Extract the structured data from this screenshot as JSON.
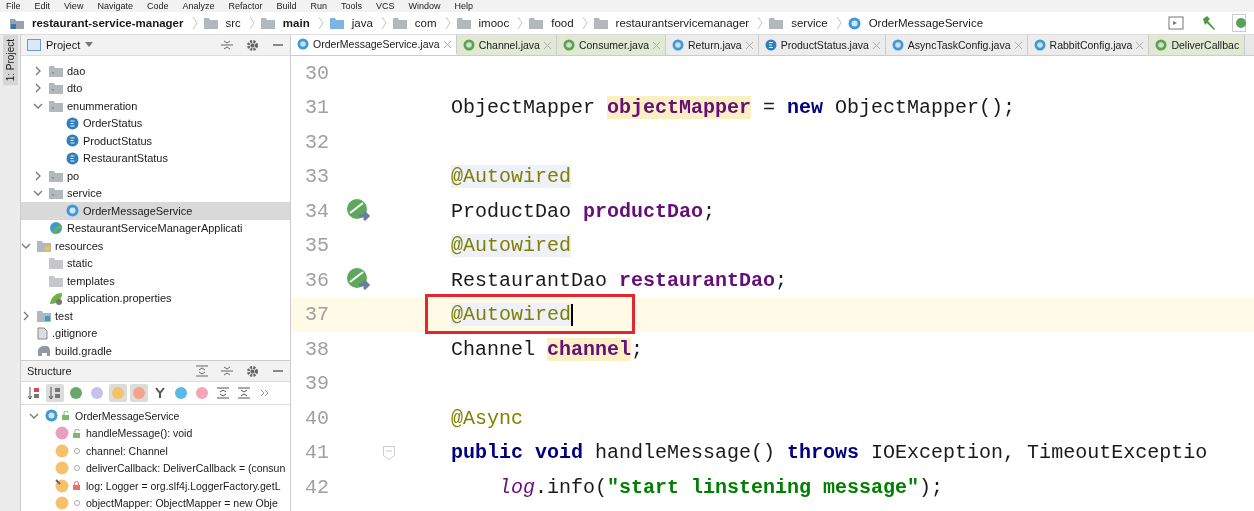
{
  "menu": [
    "File",
    "Edit",
    "View",
    "Navigate",
    "Code",
    "Analyze",
    "Refactor",
    "Build",
    "Run",
    "Tools",
    "VCS",
    "Window",
    "Help"
  ],
  "breadcrumb": [
    {
      "label": "restaurant-service-manager",
      "kind": "module"
    },
    {
      "label": "src",
      "kind": "folder"
    },
    {
      "label": "main",
      "kind": "sourceset"
    },
    {
      "label": "java",
      "kind": "source"
    },
    {
      "label": "com",
      "kind": "folder"
    },
    {
      "label": "imooc",
      "kind": "folder"
    },
    {
      "label": "food",
      "kind": "folder"
    },
    {
      "label": "restaurantservicemanager",
      "kind": "folder"
    },
    {
      "label": "service",
      "kind": "folder"
    },
    {
      "label": "OrderMessageService",
      "kind": "class"
    }
  ],
  "side_strip": {
    "label": "1: Project"
  },
  "project": {
    "title": "Project",
    "tree": [
      {
        "children": [
          {
            "children": [
              {
                "label": "dao",
                "kind": "package",
                "expanded": false,
                "selected": false
              },
              {
                "label": "dto",
                "kind": "package",
                "expanded": false,
                "selected": false
              },
              {
                "label": "enummeration",
                "kind": "package",
                "expanded": true,
                "selected": false,
                "children": [
                  {
                    "label": "OrderStatus",
                    "kind": "enum",
                    "selected": false
                  },
                  {
                    "label": "ProductStatus",
                    "kind": "enum",
                    "selected": false
                  },
                  {
                    "label": "RestaurantStatus",
                    "kind": "enum",
                    "selected": false
                  }
                ]
              },
              {
                "label": "po",
                "kind": "package",
                "expanded": false,
                "selected": false
              },
              {
                "label": "service",
                "kind": "package",
                "expanded": true,
                "selected": false,
                "children": [
                  {
                    "label": "OrderMessageService",
                    "kind": "class",
                    "selected": true
                  }
                ]
              },
              {
                "label": "RestaurantServiceManagerApplicati",
                "kind": "app",
                "selected": false
              }
            ]
          },
          {
            "label": "resources",
            "kind": "resources",
            "expanded": true,
            "selected": false,
            "children": [
              {
                "label": "static",
                "kind": "folder",
                "selected": false
              },
              {
                "label": "templates",
                "kind": "folder",
                "selected": false
              },
              {
                "label": "application.properties",
                "kind": "properties",
                "selected": false
              }
            ]
          }
        ]
      },
      {
        "label": "test",
        "kind": "testfolder",
        "expanded": false,
        "selected": false
      },
      {
        "label": ".gitignore",
        "kind": "file",
        "selected": false
      },
      {
        "label": "build.gradle",
        "kind": "gradle",
        "selected": false
      }
    ]
  },
  "structure": {
    "title": "Structure",
    "toolbar": [
      {
        "kind": "sort-alpha",
        "selected": false
      },
      {
        "kind": "sort-visibility",
        "selected": true
      },
      {
        "kind": "inherited",
        "selected": false
      },
      {
        "kind": "properties",
        "selected": false
      },
      {
        "kind": "fields",
        "selected": true
      },
      {
        "kind": "non-public",
        "selected": true
      },
      {
        "kind": "hierarchy",
        "selected": false
      },
      {
        "kind": "anonymous",
        "selected": false
      },
      {
        "kind": "lambdas",
        "selected": false
      },
      {
        "kind": "expand",
        "selected": false
      },
      {
        "kind": "collapse",
        "selected": false
      },
      {
        "kind": "more",
        "selected": false
      }
    ],
    "root": {
      "label": "OrderMessageService",
      "expanded": true,
      "children": [
        {
          "label": "handleMessage(): void",
          "kind": "public-method"
        },
        {
          "label": "channel: Channel",
          "kind": "package-field"
        },
        {
          "label": "deliverCallback: DeliverCallback = (consun",
          "kind": "package-field"
        },
        {
          "label": "log: Logger = org.slf4j.LoggerFactory.getL",
          "kind": "private-static-field"
        },
        {
          "label": "objectMapper: ObjectMapper = new Obje",
          "kind": "package-field"
        }
      ]
    }
  },
  "tabs": [
    {
      "label": "OrderMessageService.java",
      "kind": "class",
      "selected": true
    },
    {
      "label": "Channel.java",
      "kind": "interface",
      "selected": false
    },
    {
      "label": "Consumer.java",
      "kind": "interface",
      "selected": false
    },
    {
      "label": "Return.java",
      "kind": "class",
      "selected": false
    },
    {
      "label": "ProductStatus.java",
      "kind": "enum",
      "selected": false
    },
    {
      "label": "AsyncTaskConfig.java",
      "kind": "class",
      "selected": false
    },
    {
      "label": "RabbitConfig.java",
      "kind": "class",
      "selected": false
    },
    {
      "label": "DeliverCallbac",
      "kind": "interface",
      "selected": false
    }
  ],
  "code": [
    {
      "number": "30",
      "current": false,
      "boxed": false,
      "bean_marker": false,
      "fold_marker": false
    },
    {
      "number": "31",
      "current": false,
      "boxed": false,
      "bean_marker": false,
      "fold_marker": false,
      "tokens": [
        {
          "t": "ObjectMapper ",
          "kind": "plain"
        },
        {
          "t": "objectMapper",
          "kind": "field-hit"
        },
        {
          "t": " = ",
          "kind": "plain"
        },
        {
          "t": "new",
          "kind": "keyword"
        },
        {
          "t": " ObjectMapper();",
          "kind": "plain"
        }
      ]
    },
    {
      "number": "32",
      "current": false,
      "boxed": false,
      "bean_marker": false,
      "fold_marker": false
    },
    {
      "number": "33",
      "current": false,
      "boxed": false,
      "bean_marker": false,
      "fold_marker": false,
      "tokens": [
        {
          "t": "@Autowired",
          "kind": "annotation"
        }
      ]
    },
    {
      "number": "34",
      "current": false,
      "boxed": false,
      "bean_marker": true,
      "fold_marker": false,
      "tokens": [
        {
          "t": "ProductDao ",
          "kind": "plain"
        },
        {
          "t": "productDao",
          "kind": "field"
        },
        {
          "t": ";",
          "kind": "plain"
        }
      ]
    },
    {
      "number": "35",
      "current": false,
      "boxed": false,
      "bean_marker": false,
      "fold_marker": false,
      "tokens": [
        {
          "t": "@Autowired",
          "kind": "annotation"
        }
      ]
    },
    {
      "number": "36",
      "current": false,
      "boxed": false,
      "bean_marker": true,
      "fold_marker": false,
      "tokens": [
        {
          "t": "RestaurantDao ",
          "kind": "plain"
        },
        {
          "t": "restaurantDao",
          "kind": "field"
        },
        {
          "t": ";",
          "kind": "plain"
        }
      ]
    },
    {
      "number": "37",
      "current": true,
      "boxed": true,
      "bean_marker": false,
      "fold_marker": false,
      "tokens": [
        {
          "t": "@Autowired",
          "kind": "annotation"
        }
      ]
    },
    {
      "number": "38",
      "current": false,
      "boxed": false,
      "bean_marker": false,
      "fold_marker": false,
      "tokens": [
        {
          "t": "Channel ",
          "kind": "plain"
        },
        {
          "t": "channel",
          "kind": "field-hit"
        },
        {
          "t": ";",
          "kind": "plain"
        }
      ]
    },
    {
      "number": "39",
      "current": false,
      "boxed": false,
      "bean_marker": false,
      "fold_marker": false
    },
    {
      "number": "40",
      "current": false,
      "boxed": false,
      "bean_marker": false,
      "fold_marker": false,
      "tokens": [
        {
          "t": "@Async",
          "kind": "annotation-plain"
        }
      ]
    },
    {
      "number": "41",
      "current": false,
      "boxed": false,
      "bean_marker": false,
      "fold_marker": true,
      "tokens": [
        {
          "t": "public void",
          "kind": "keyword"
        },
        {
          "t": " handleMessage() ",
          "kind": "plain"
        },
        {
          "t": "throws",
          "kind": "keyword"
        },
        {
          "t": " IOException, TimeoutExceptio",
          "kind": "plain"
        }
      ],
      "children": [
        {
          "number": "42",
          "current": false,
          "boxed": false,
          "bean_marker": false,
          "fold_marker": false,
          "tokens": [
            {
              "t": "log",
              "kind": "static"
            },
            {
              "t": ".info(",
              "kind": "plain"
            },
            {
              "t": "\"start linstening message\"",
              "kind": "string"
            },
            {
              "t": ");",
              "kind": "plain"
            }
          ]
        }
      ]
    }
  ]
}
